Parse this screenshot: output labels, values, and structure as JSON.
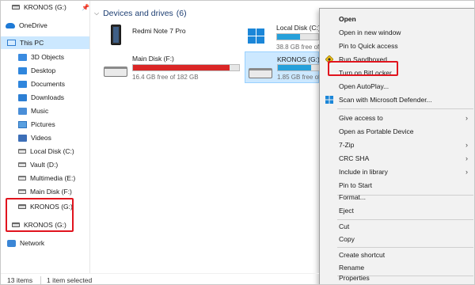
{
  "nav": {
    "top_item": "KRONOS (G:)",
    "pin_glyph": "📌",
    "onedrive": "OneDrive",
    "this_pc": "This PC",
    "items": [
      {
        "label": "3D Objects",
        "icon": "3d-objects-icon"
      },
      {
        "label": "Desktop",
        "icon": "desktop-icon"
      },
      {
        "label": "Documents",
        "icon": "documents-icon"
      },
      {
        "label": "Downloads",
        "icon": "downloads-icon"
      },
      {
        "label": "Music",
        "icon": "music-icon"
      },
      {
        "label": "Pictures",
        "icon": "pictures-icon"
      },
      {
        "label": "Videos",
        "icon": "videos-icon"
      },
      {
        "label": "Local Disk (C:)",
        "icon": "drive-icon"
      },
      {
        "label": "Vault (D:)",
        "icon": "drive-icon"
      },
      {
        "label": "Multimedia (E:)",
        "icon": "drive-icon"
      },
      {
        "label": "Main Disk (F:)",
        "icon": "drive-icon"
      },
      {
        "label": "KRONOS (G:)",
        "icon": "drive-icon"
      }
    ],
    "kronos_root": "KRONOS (G:)",
    "network": "Network"
  },
  "main": {
    "group_title": "Devices and drives",
    "group_count": "(6)",
    "chevron": "⌵",
    "tiles": {
      "phone": {
        "name": "Redmi Note 7 Pro"
      },
      "local_c": {
        "name": "Local Disk (C:)",
        "free": "38.8 GB free of",
        "used_fraction": 0.55
      },
      "main_f": {
        "name": "Main Disk (F:)",
        "free": "16.4 GB free of 182 GB",
        "used_fraction": 0.91
      },
      "kronos": {
        "name": "KRONOS (G:)",
        "free": "1.85 GB free of",
        "used_fraction": 0.8
      }
    }
  },
  "context_menu": {
    "items": [
      {
        "label": "Open",
        "bold": true
      },
      {
        "label": "Open in new window"
      },
      {
        "label": "Pin to Quick access"
      },
      {
        "label": "Run Sandboxed",
        "icon": "sandbox-icon"
      },
      {
        "label": "Turn on BitLocker"
      },
      {
        "label": "Open AutoPlay..."
      },
      {
        "label": "Scan with Microsoft Defender...",
        "icon": "defender-icon"
      },
      {
        "label": "Give access to",
        "submenu": true
      },
      {
        "label": "Open as Portable Device"
      },
      {
        "label": "7-Zip",
        "submenu": true
      },
      {
        "label": "CRC SHA",
        "submenu": true
      },
      {
        "label": "Include in library",
        "submenu": true
      },
      {
        "label": "Pin to Start"
      },
      {
        "label": "Format..."
      },
      {
        "label": "Eject"
      },
      {
        "label": "Cut"
      },
      {
        "label": "Copy"
      },
      {
        "label": "Create shortcut"
      },
      {
        "label": "Rename"
      },
      {
        "label": "Properties"
      }
    ],
    "submenu_glyph": "›"
  },
  "status": {
    "items_count": "13 items",
    "selection": "1 item selected"
  },
  "colors": {
    "selection_bg": "#cce8ff",
    "bar_normal": "#26a0da",
    "bar_full": "#da2626",
    "highlight_box": "#e1141e",
    "header_text": "#1e3f73"
  }
}
